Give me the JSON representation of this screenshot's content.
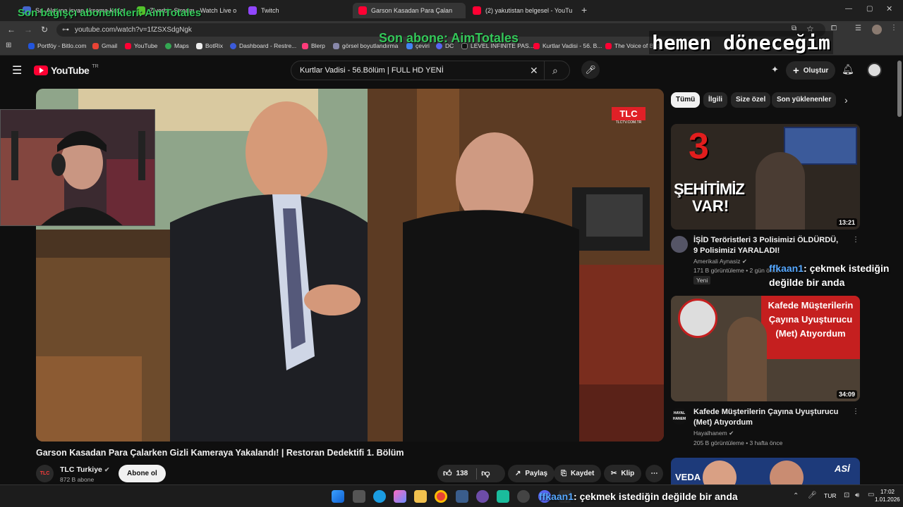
{
  "browser": {
    "tabs": [
      {
        "title": "Sa. Alayına isyan akşama kadar"
      },
      {
        "title": "Ziverbin Stream - Watch Live o"
      },
      {
        "title": "Twitch"
      },
      {
        "title": "Garson Kasadan Para Çalan"
      },
      {
        "title": "(2) yakutistan belgesel - YouTu"
      }
    ],
    "url": "youtube.com/watch?v=1fZSXSdgNgk",
    "bookmarks": [
      "Portföy - Bitlo.com",
      "Gmail",
      "YouTube",
      "Maps",
      "BotRix",
      "Dashboard - Restre...",
      "Blerp",
      "görsel boyutlandırma",
      "çeviri",
      "DC",
      "LEVEL INFINITE PAS...",
      "Kurtlar Vadisi - 56. B...",
      "The Voice of Bat..."
    ]
  },
  "youtube": {
    "logo_text": "YouTube",
    "logo_sup": "TR",
    "search_value": "Kurtlar Vadisi - 56.Bölüm | FULL HD YENİ",
    "create_label": "Oluştur",
    "video": {
      "title": "Garson Kasadan Para Çalarken Gizli Kameraya Yakalandı! | Restoran Dedektifi 1. Bölüm",
      "channel": "TLC Turkiye",
      "subscribers": "872 B abone",
      "subscribe_label": "Abone ol",
      "likes": "138",
      "share_label": "Paylaş",
      "save_label": "Kaydet",
      "clip_label": "Klip",
      "watermark": "TLC",
      "watermark_sub": "TLCTV.COM.TR",
      "channel_badge": "TLC"
    },
    "chips": [
      "Tümü",
      "İlgili",
      "Size özel",
      "Son yüklenenler"
    ],
    "recommendations": [
      {
        "title": "İŞİD Teröristleri 3 Polisimizi ÖLDÜRDÜ, 9 Polisimizi YARALADI!",
        "channel": "Amerikali Aynasiz",
        "meta": "171 B görüntüleme • 2 gün önce",
        "badge": "Yeni",
        "duration": "13:21",
        "thumb_text_1": "3",
        "thumb_text_2": "ŞEHİTİMİZ",
        "thumb_text_3": "VAR!"
      },
      {
        "title": "Kafede Müşterilerin Çayına Uyuşturucu (Met) Atıyordum",
        "channel": "Hayalhanem",
        "meta": "205 B görüntüleme • 3 hafta önce",
        "duration": "34:09",
        "thumb_text_1": "Kafede Müşterilerin Çayına Uyuşturucu (Met) Atıyordum",
        "avatar_text": "HAYAL HANEM"
      },
      {
        "title": "",
        "thumb_text_1": "VEDA",
        "thumb_text_2": "ASİ"
      }
    ]
  },
  "overlay": {
    "top_left": "Son bağışçı aboneilkleri: AimTotales",
    "top_center": "Son abone: AimTotales",
    "top_right": "hemen döneceğim",
    "chat1_user": "ffkaan1",
    "chat1_text": ": çekmek istediğin değilde bir anda",
    "chat2_user": "ffkaan1",
    "chat2_text": ": çekmek istediğin değilde bir anda"
  },
  "taskbar": {
    "lang": "TUR",
    "time": "17:02",
    "date": "1.01.2026"
  }
}
